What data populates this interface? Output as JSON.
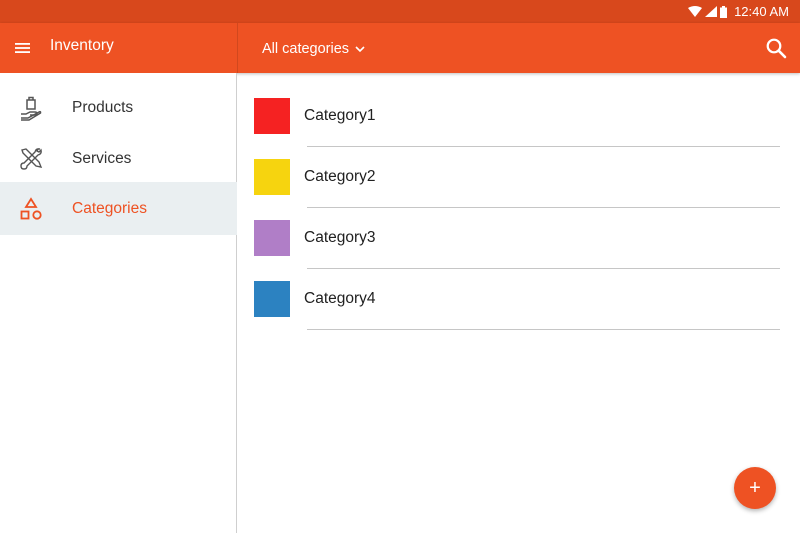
{
  "status_bar": {
    "time": "12:40 AM",
    "icons": [
      "wifi-icon",
      "cell-signal-icon",
      "battery-icon"
    ]
  },
  "app_bar": {
    "title": "Inventory",
    "menu_icon": "hamburger-menu-icon",
    "category_filter": "All categories",
    "category_filter_icon": "chevron-down-icon",
    "search_icon": "search-icon"
  },
  "sidebar": {
    "items": [
      {
        "label": "Products",
        "icon": "products-icon",
        "active": false
      },
      {
        "label": "Services",
        "icon": "services-icon",
        "active": false
      },
      {
        "label": "Categories",
        "icon": "categories-icon",
        "active": true
      }
    ]
  },
  "categories": [
    {
      "name": "Category1",
      "color": "#f52222"
    },
    {
      "name": "Category2",
      "color": "#f6d40f"
    },
    {
      "name": "Category3",
      "color": "#b07ec7"
    },
    {
      "name": "Category4",
      "color": "#2c82c1"
    }
  ],
  "fab": {
    "label": "+",
    "icon": "add-icon"
  },
  "colors": {
    "primary": "#ee5223",
    "status_bar": "#d8481c",
    "active_nav_bg": "#eaeff1"
  }
}
